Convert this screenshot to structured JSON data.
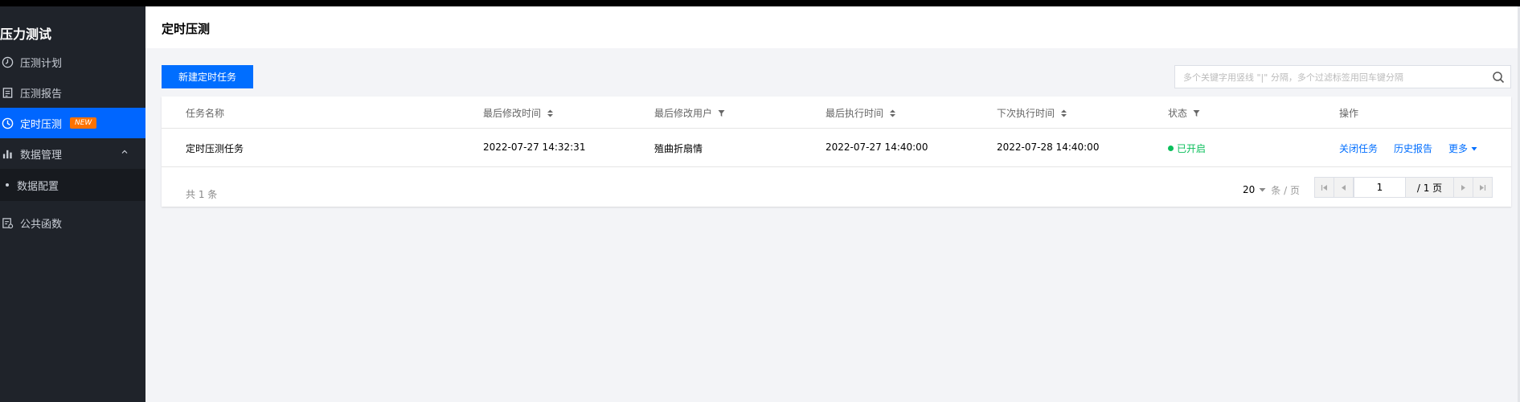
{
  "sidebar": {
    "title": "压力测试",
    "items": [
      {
        "label": "压测计划",
        "icon": "clock-icon"
      },
      {
        "label": "压测报告",
        "icon": "report-icon"
      },
      {
        "label": "定时压测",
        "icon": "timer-icon",
        "badge": "NEW"
      },
      {
        "label": "数据管理",
        "icon": "bar-chart-icon"
      },
      {
        "label": "数据配置"
      },
      {
        "label": "公共函数",
        "icon": "function-icon"
      }
    ]
  },
  "header": {
    "title": "定时压测"
  },
  "toolbar": {
    "new_task_label": "新建定时任务",
    "search_placeholder": "多个关键字用竖线 \"|\" 分隔，多个过滤标签用回车键分隔"
  },
  "table": {
    "columns": [
      "任务名称",
      "最后修改时间",
      "最后修改用户",
      "最后执行时间",
      "下次执行时间",
      "状态",
      "操作"
    ],
    "rows": [
      {
        "name": "定时压测任务",
        "modified_time": "2022-07-27 14:32:31",
        "modified_user": "殖曲折扇情",
        "last_run": "2022-07-27 14:40:00",
        "next_run": "2022-07-28 14:40:00",
        "status": "已开启",
        "actions": [
          "关闭任务",
          "历史报告",
          "更多"
        ]
      }
    ]
  },
  "pagination": {
    "total_text": "共 1 条",
    "page_size": "20",
    "page_size_unit": "条 / 页",
    "current_page": "1",
    "total_pages": "/ 1 页"
  },
  "colors": {
    "primary": "#006eff",
    "sidebar_bg": "#1f232a",
    "status_on": "#0abf5b",
    "badge": "#ff7200"
  }
}
